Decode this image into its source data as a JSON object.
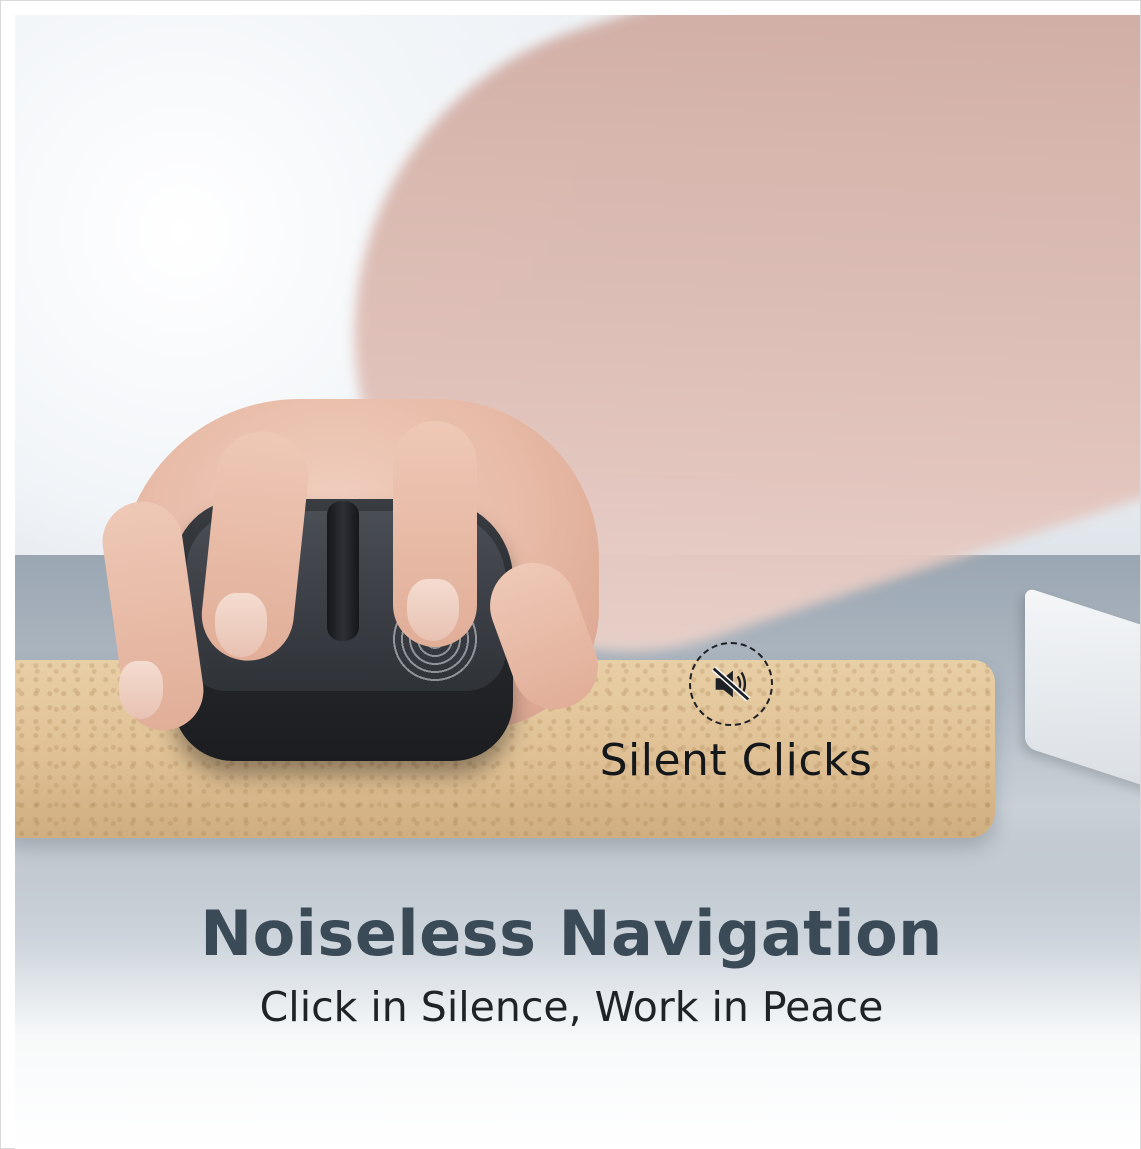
{
  "badge": {
    "icon": "muted-speaker-icon",
    "label": "Silent Clicks"
  },
  "headline": "Noiseless Navigation",
  "subline": "Click in Silence, Work in Peace",
  "colors": {
    "headline": "#3b4a57",
    "text": "#1f2326",
    "cork": "#dfc094",
    "sleeve": "#d8b6ad",
    "mouse": "#26292d"
  }
}
